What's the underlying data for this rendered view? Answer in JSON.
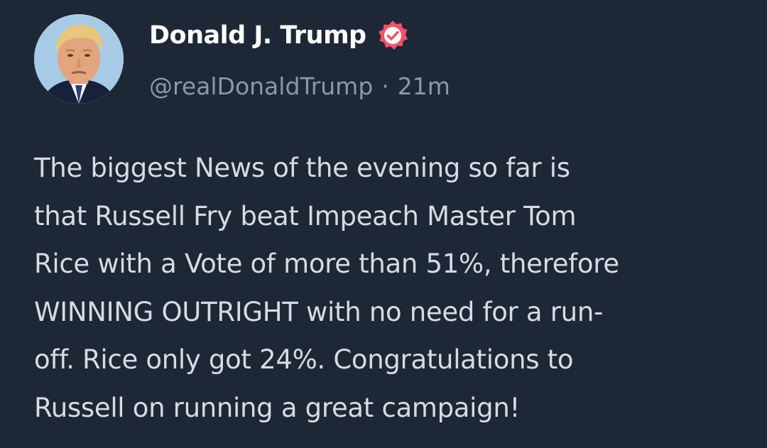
{
  "post": {
    "author": {
      "display_name": "Donald J. Trump",
      "handle": "@realDonaldTrump",
      "verified": true,
      "avatar_icon": "profile-photo"
    },
    "separator": "·",
    "time": "21m",
    "body_lines": [
      "The biggest News of the evening so far is",
      "that Russell Fry beat Impeach Master Tom",
      "Rice with a Vote of more than 51%, therefore",
      "WINNING OUTRIGHT with no need for a run-",
      "off. Rice only got 24%. Congratulations to",
      "Russell on running a great campaign!"
    ]
  },
  "theme": {
    "background": "#1e2736",
    "name_color": "#ffffff",
    "meta_color": "#8d97a8",
    "body_color": "#d7dbe2",
    "verified_badge_color": "#f0536b"
  }
}
